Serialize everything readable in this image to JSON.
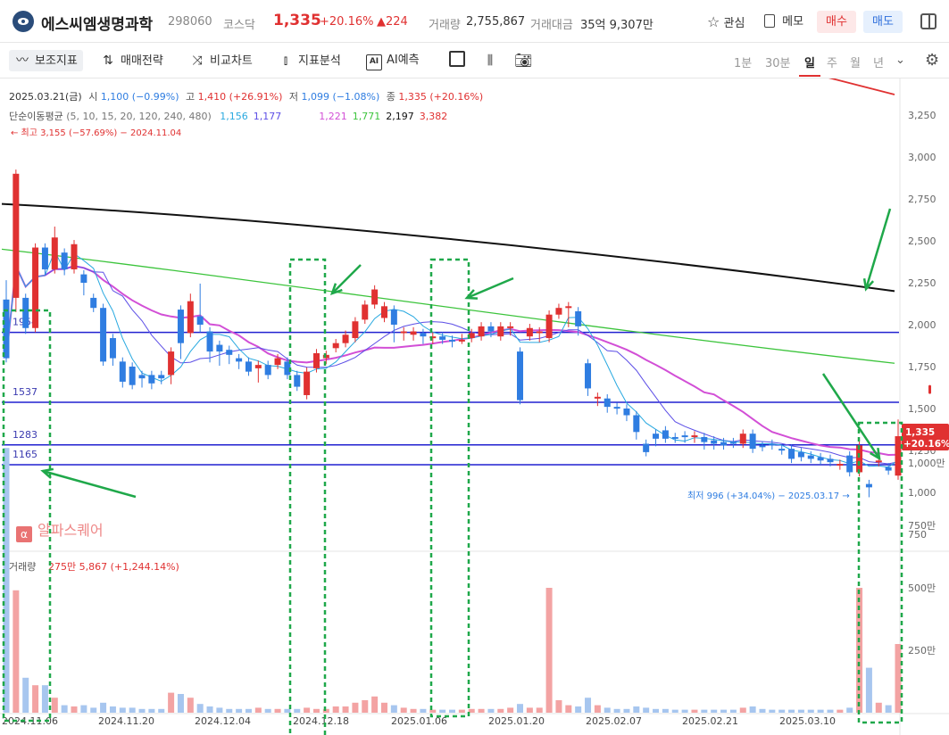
{
  "header": {
    "stock_name": "에스씨엠생명과학",
    "code": "298060",
    "market": "코스닥",
    "price": "1,335",
    "change_pct": "+20.16%",
    "change_amt": "▲224",
    "volume_label": "거래량",
    "volume": "2,755,867",
    "turnover_label": "거래대금",
    "turnover": "35억 9,307만",
    "watch_label": "관심",
    "memo_label": "메모",
    "buy_label": "매수",
    "sell_label": "매도"
  },
  "toolbar": {
    "indicator_label": "보조지표",
    "strategy_label": "매매전략",
    "compare_label": "비교차트",
    "analysis_label": "지표분석",
    "ai_label": "AI예측",
    "periods": [
      "1분",
      "30분",
      "일",
      "주",
      "월",
      "년"
    ],
    "selected_period": "일"
  },
  "info": {
    "date": "2025.03.21(금)",
    "open_label": "시",
    "open": "1,100 (−0.99%)",
    "high_label": "고",
    "high": "1,410 (+26.91%)",
    "low_label": "저",
    "low": "1,099 (−1.08%)",
    "close_label": "종",
    "close": "1,335 (+20.16%)",
    "ma_label": "단순이동평균",
    "ma_params": "(5, 10, 15, 20, 120, 240, 480)",
    "ma_values": [
      {
        "value": "1,156",
        "color": "#29a9e0"
      },
      {
        "value": "1,177",
        "color": "#5c4ee6"
      },
      {
        "value": "1,221",
        "color": "#d24fd6"
      },
      {
        "value": "1,771",
        "color": "#3cc43c"
      },
      {
        "value": "2,197",
        "color": "#111111"
      },
      {
        "value": "3,382",
        "color": "#e03131"
      }
    ],
    "max_note": "최고 3,155 (−57.69%) − 2024.11.04",
    "min_note": "최저 996 (+34.04%) − 2025.03.17",
    "last_price": "1,335",
    "last_pct": "+20.16%",
    "volume_title": "거래량",
    "volume_info": "275만 5,867 (+1,244.14%)",
    "watermark": "알파스퀘어"
  },
  "colors": {
    "up": "#e03131",
    "down": "#2f7de1",
    "hline": "#2020d0",
    "annot": "#1fa84a"
  },
  "chart_data": {
    "type": "candlestick",
    "y_ticks": [
      "3,250",
      "3,000",
      "2,750",
      "2,500",
      "2,250",
      "2,000",
      "1,750",
      "1,500",
      "1,250",
      "1,000",
      "750"
    ],
    "vol_ticks": [
      "1,000만",
      "750만",
      "500만",
      "250만"
    ],
    "x_ticks": [
      "2024.11.06",
      "2024.11.20",
      "2024.12.04",
      "2024.12.18",
      "2025.01.06",
      "2025.01.20",
      "2025.02.07",
      "2025.02.21",
      "2025.03.10"
    ],
    "horizontal_lines": [
      "1954",
      "1537",
      "1283",
      "1165"
    ],
    "candles": [
      [
        2150,
        2240,
        1900,
        1800,
        1060,
        3155,
        1950,
        1950
      ],
      [
        2160,
        2240,
        2100,
        2900,
        490
      ],
      [
        2160,
        2160,
        1970,
        1980,
        140
      ],
      [
        1980,
        2460,
        1980,
        2460,
        110
      ],
      [
        2460,
        2460,
        2320,
        2330,
        110
      ],
      [
        2330,
        2560,
        2330,
        2520,
        60
      ],
      [
        2430,
        2430,
        2320,
        2330,
        30
      ],
      [
        2330,
        2480,
        2330,
        2480,
        25
      ],
      [
        2300,
        2300,
        2200,
        2250,
        30
      ],
      [
        2160,
        2160,
        2100,
        2100,
        20
      ],
      [
        2100,
        2100,
        1790,
        1780,
        40
      ],
      [
        1920,
        1920,
        1780,
        1800,
        25
      ],
      [
        1780,
        1780,
        1650,
        1660,
        20
      ],
      [
        1750,
        1750,
        1640,
        1640,
        20
      ],
      [
        1700,
        1700,
        1650,
        1680,
        15
      ],
      [
        1700,
        1700,
        1640,
        1650,
        15
      ],
      [
        1700,
        1700,
        1670,
        1680,
        15
      ],
      [
        1700,
        1840,
        1670,
        1840,
        80
      ],
      [
        2090,
        2090,
        1820,
        1890,
        75
      ],
      [
        1950,
        2160,
        1950,
        2140,
        60
      ],
      [
        2050,
        2220,
        1980,
        2000,
        35
      ],
      [
        1960,
        1960,
        1800,
        1840,
        25
      ],
      [
        1880,
        1880,
        1780,
        1840,
        20
      ],
      [
        1850,
        1850,
        1790,
        1820,
        15
      ],
      [
        1800,
        1800,
        1760,
        1780,
        15
      ],
      [
        1780,
        1780,
        1720,
        1720,
        15
      ],
      [
        1740,
        1740,
        1680,
        1760,
        20
      ],
      [
        1760,
        1760,
        1700,
        1700,
        15
      ],
      [
        1760,
        1760,
        1760,
        1800,
        15
      ],
      [
        1780,
        1780,
        1700,
        1700,
        15
      ],
      [
        1700,
        1700,
        1630,
        1630,
        15
      ],
      [
        1580,
        1580,
        1580,
        1720,
        20
      ],
      [
        1740,
        1740,
        1790,
        1830,
        15
      ],
      [
        1800,
        1800,
        1790,
        1820,
        15
      ],
      [
        1860,
        1860,
        1860,
        1890,
        25
      ],
      [
        1890,
        1890,
        1900,
        1940,
        25
      ],
      [
        1920,
        1920,
        1980,
        2020,
        40
      ],
      [
        2030,
        2030,
        2080,
        2120,
        50
      ],
      [
        2120,
        2120,
        2150,
        2210,
        65
      ],
      [
        2040,
        2040,
        2060,
        2110,
        40
      ],
      [
        2090,
        2090,
        1920,
        2000,
        30
      ],
      [
        1960,
        1960,
        1930,
        1960,
        20
      ],
      [
        1940,
        1940,
        1930,
        1960,
        15
      ],
      [
        1950,
        1950,
        1910,
        1930,
        15
      ],
      [
        1930,
        1930,
        1910,
        1930,
        12
      ],
      [
        1930,
        1930,
        1910,
        1910,
        12
      ],
      [
        1910,
        1910,
        1890,
        1900,
        12
      ],
      [
        1910,
        1910,
        1920,
        1910,
        12
      ],
      [
        1920,
        1920,
        1940,
        1950,
        15
      ],
      [
        1930,
        1930,
        1970,
        1990,
        15
      ],
      [
        1990,
        1990,
        1950,
        1960,
        15
      ],
      [
        1930,
        1930,
        1940,
        1990,
        15
      ],
      [
        1990,
        1990,
        1960,
        1990,
        20
      ],
      [
        1840,
        1840,
        1550,
        1550,
        35
      ],
      [
        1930,
        1930,
        1940,
        1980,
        20
      ],
      [
        1960,
        1960,
        1920,
        1960,
        20
      ],
      [
        1920,
        1920,
        2020,
        2060,
        500
      ],
      [
        2060,
        2060,
        2080,
        2100,
        50
      ],
      [
        2100,
        2100,
        2010,
        2110,
        30
      ],
      [
        2080,
        2080,
        1960,
        1990,
        25
      ],
      [
        1770,
        1770,
        1600,
        1620,
        60
      ],
      [
        1560,
        1560,
        1540,
        1570,
        30
      ],
      [
        1560,
        1560,
        1500,
        1510,
        20
      ],
      [
        1510,
        1510,
        1490,
        1500,
        15
      ],
      [
        1500,
        1500,
        1450,
        1460,
        15
      ],
      [
        1460,
        1460,
        1340,
        1360,
        25
      ],
      [
        1290,
        1290,
        1250,
        1240,
        20
      ],
      [
        1350,
        1350,
        1300,
        1320,
        15
      ],
      [
        1370,
        1370,
        1340,
        1320,
        15
      ],
      [
        1330,
        1330,
        1320,
        1320,
        12
      ],
      [
        1340,
        1340,
        1320,
        1330,
        12
      ],
      [
        1340,
        1340,
        1320,
        1340,
        12
      ],
      [
        1330,
        1330,
        1280,
        1300,
        12
      ],
      [
        1310,
        1310,
        1280,
        1290,
        12
      ],
      [
        1300,
        1300,
        1280,
        1280,
        12
      ],
      [
        1300,
        1300,
        1290,
        1290,
        12
      ],
      [
        1290,
        1290,
        1300,
        1350,
        20
      ],
      [
        1350,
        1350,
        1270,
        1260,
        25
      ],
      [
        1280,
        1280,
        1270,
        1270,
        15
      ],
      [
        1290,
        1290,
        1280,
        1280,
        12
      ],
      [
        1260,
        1260,
        1260,
        1250,
        12
      ],
      [
        1260,
        1260,
        1210,
        1200,
        12
      ],
      [
        1240,
        1240,
        1220,
        1210,
        12
      ],
      [
        1220,
        1220,
        1200,
        1200,
        12
      ],
      [
        1210,
        1210,
        1200,
        1190,
        12
      ],
      [
        1200,
        1200,
        1190,
        1180,
        12
      ],
      [
        1170,
        1170,
        1160,
        1170,
        12
      ],
      [
        1220,
        1220,
        1150,
        1120,
        20
      ],
      [
        1120,
        1120,
        1240,
        1280,
        500
      ],
      [
        1050,
        1050,
        996,
        1030,
        180
      ],
      [
        1180,
        1180,
        1190,
        1190,
        40
      ],
      [
        1150,
        1150,
        1140,
        1130,
        30
      ],
      [
        1100,
        1100,
        1410,
        1335,
        275
      ]
    ]
  }
}
